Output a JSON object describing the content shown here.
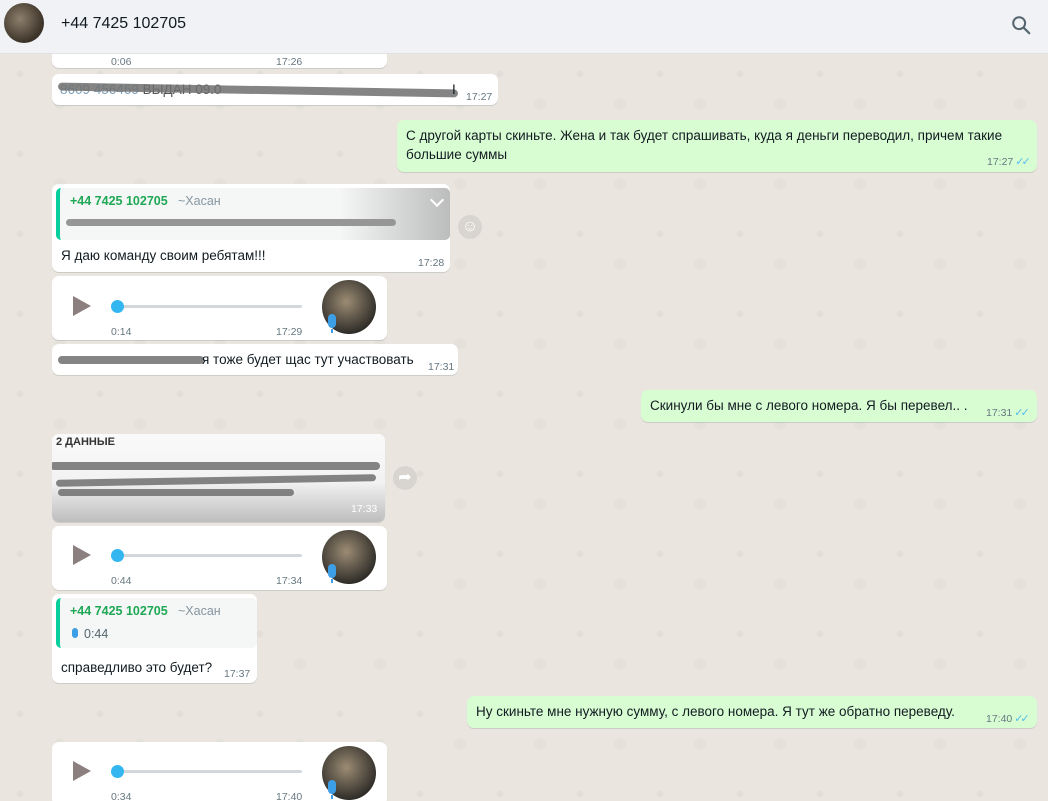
{
  "header": {
    "contact_name": "+44 7425 102705"
  },
  "icons": {
    "search": "search-icon",
    "emoji": "emoji-icon",
    "forward": "forward-icon"
  },
  "messages": {
    "m0": {
      "duration": "0:06",
      "time": "17:26"
    },
    "m1": {
      "visible_text": "ВЫДАН 09.0",
      "visible_text_end": "І",
      "time": "17:27"
    },
    "m2": {
      "line1": "С другой карты скиньте. Жена и так будет спрашивать, куда я деньги переводил, причем такие",
      "line2": "большие суммы",
      "time": "17:27"
    },
    "m3": {
      "quote_name": "+44 7425 102705",
      "quote_alias": "~Хасан",
      "text": "Я даю команду своим ребятам!!!",
      "time": "17:28"
    },
    "m4": {
      "duration": "0:14",
      "time": "17:29"
    },
    "m5": {
      "text": "я тоже будет щас тут участвовать",
      "time": "17:31"
    },
    "m6": {
      "text": "Скинули бы мне с левого номера. Я бы перевел.. .",
      "time": "17:31"
    },
    "m7": {
      "time": "17:33"
    },
    "m8": {
      "duration": "0:44",
      "time": "17:34"
    },
    "m9": {
      "quote_name": "+44 7425 102705",
      "quote_alias": "~Хасан",
      "quote_duration": "0:44",
      "text": "справедливо это будет?",
      "time": "17:37"
    },
    "m10": {
      "text": "Ну скиньте мне нужную сумму, с левого номера. Я тут же обратно переведу.",
      "time": "17:40"
    },
    "m11": {
      "duration": "0:34",
      "time": "17:40"
    }
  },
  "colors": {
    "outgoing_bubble": "#d9fdd3",
    "incoming_bubble": "#ffffff",
    "quote_name": "#1fa855",
    "read_ticks": "#53bdeb"
  }
}
